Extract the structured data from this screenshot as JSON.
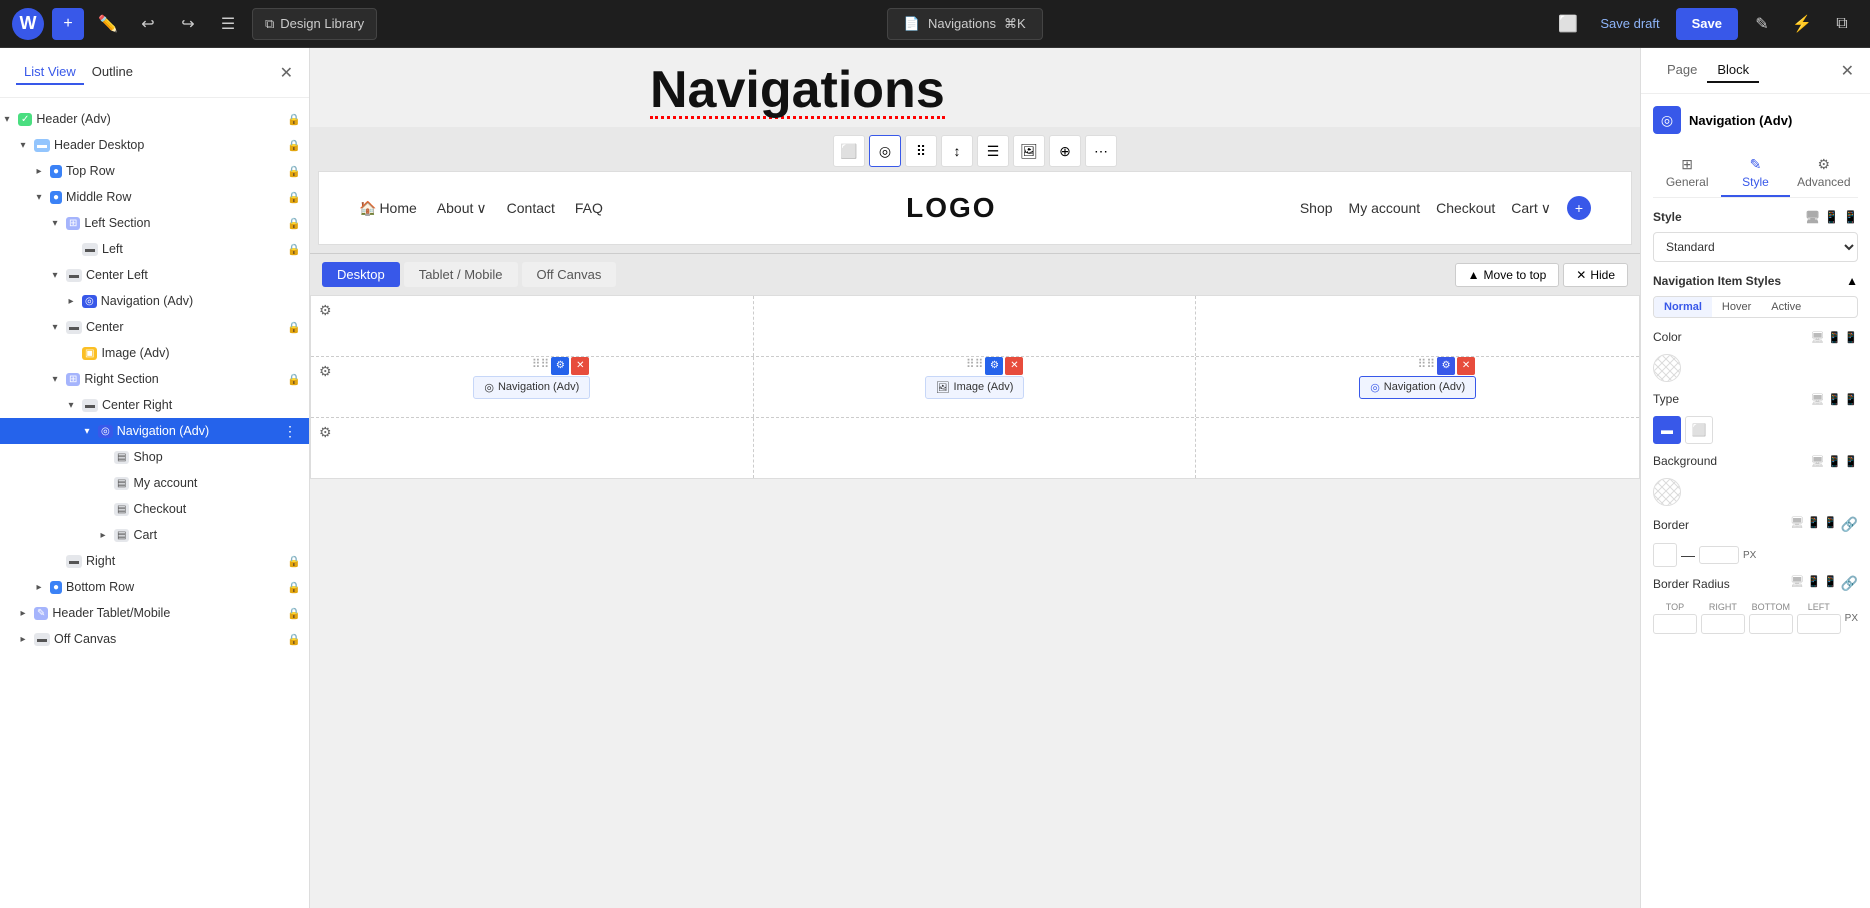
{
  "topBar": {
    "wpLogo": "W",
    "addLabel": "+",
    "designLibraryLabel": "Design Library",
    "navigationsLabel": "Navigations",
    "shortcut": "⌘K",
    "saveDraftLabel": "Save draft",
    "saveLabel": "Save"
  },
  "leftPanel": {
    "tab1": "List View",
    "tab2": "Outline",
    "tree": [
      {
        "id": "header-adv",
        "label": "Header (Adv)",
        "indent": 0,
        "expanded": true,
        "hasToggle": true,
        "icon": "☑",
        "locked": true
      },
      {
        "id": "header-desktop",
        "label": "Header Desktop",
        "indent": 1,
        "expanded": true,
        "hasToggle": true,
        "icon": "⬜",
        "locked": true
      },
      {
        "id": "top-row",
        "label": "Top Row",
        "indent": 2,
        "expanded": false,
        "hasToggle": true,
        "icon": "🔵",
        "locked": true
      },
      {
        "id": "middle-row",
        "label": "Middle Row",
        "indent": 2,
        "expanded": true,
        "hasToggle": true,
        "icon": "🔵",
        "locked": true
      },
      {
        "id": "left-section",
        "label": "Left Section",
        "indent": 3,
        "expanded": true,
        "hasToggle": true,
        "icon": "⟨⟩",
        "locked": true
      },
      {
        "id": "left",
        "label": "Left",
        "indent": 4,
        "expanded": false,
        "hasToggle": false,
        "icon": "▬",
        "locked": true
      },
      {
        "id": "center-left",
        "label": "Center Left",
        "indent": 3,
        "expanded": true,
        "hasToggle": true,
        "icon": "▬",
        "locked": false
      },
      {
        "id": "navigation-adv-1",
        "label": "Navigation (Adv)",
        "indent": 4,
        "expanded": false,
        "hasToggle": true,
        "icon": "◎",
        "locked": false
      },
      {
        "id": "center",
        "label": "Center",
        "indent": 3,
        "expanded": true,
        "hasToggle": true,
        "icon": "▬",
        "locked": true
      },
      {
        "id": "image-adv",
        "label": "Image (Adv)",
        "indent": 4,
        "expanded": false,
        "hasToggle": false,
        "icon": "🖼",
        "locked": false
      },
      {
        "id": "right-section",
        "label": "Right Section",
        "indent": 3,
        "expanded": true,
        "hasToggle": true,
        "icon": "⟨⟩",
        "locked": true
      },
      {
        "id": "center-right",
        "label": "Center Right",
        "indent": 4,
        "expanded": true,
        "hasToggle": true,
        "icon": "▬",
        "locked": false
      },
      {
        "id": "navigation-adv-2",
        "label": "Navigation (Adv)",
        "indent": 5,
        "expanded": true,
        "hasToggle": true,
        "icon": "◎",
        "locked": false,
        "selected": true
      },
      {
        "id": "shop",
        "label": "Shop",
        "indent": 6,
        "expanded": false,
        "hasToggle": false,
        "icon": "▤",
        "locked": false
      },
      {
        "id": "my-account",
        "label": "My account",
        "indent": 6,
        "expanded": false,
        "hasToggle": false,
        "icon": "▤",
        "locked": false
      },
      {
        "id": "checkout",
        "label": "Checkout",
        "indent": 6,
        "expanded": false,
        "hasToggle": false,
        "icon": "▤",
        "locked": false
      },
      {
        "id": "cart",
        "label": "Cart",
        "indent": 6,
        "expanded": false,
        "hasToggle": true,
        "icon": "▤",
        "locked": false
      },
      {
        "id": "right",
        "label": "Right",
        "indent": 3,
        "expanded": false,
        "hasToggle": false,
        "icon": "▬",
        "locked": true
      },
      {
        "id": "bottom-row",
        "label": "Bottom Row",
        "indent": 2,
        "expanded": false,
        "hasToggle": true,
        "icon": "🔵",
        "locked": true
      },
      {
        "id": "header-tablet-mobile",
        "label": "Header Tablet/Mobile",
        "indent": 1,
        "expanded": false,
        "hasToggle": true,
        "icon": "✎",
        "locked": true
      },
      {
        "id": "off-canvas",
        "label": "Off Canvas",
        "indent": 1,
        "expanded": false,
        "hasToggle": true,
        "icon": "▬",
        "locked": true
      }
    ]
  },
  "canvas": {
    "pageTitle": "Navigations",
    "navItems": {
      "home": "Home",
      "about": "About",
      "contact": "Contact",
      "faq": "FAQ",
      "logo": "LOGO",
      "shop": "Shop",
      "myAccount": "My account",
      "checkout": "Checkout",
      "cart": "Cart"
    },
    "viewTabs": [
      "Desktop",
      "Tablet / Mobile",
      "Off Canvas"
    ],
    "activeViewTab": "Desktop",
    "moveToTopLabel": "Move to top",
    "hideLabel": "Hide",
    "gridBlocks": [
      {
        "id": "nav-left",
        "label": "Navigation (Adv)",
        "type": "nav"
      },
      {
        "id": "image-center",
        "label": "Image (Adv)",
        "type": "image"
      },
      {
        "id": "nav-right",
        "label": "Navigation (Adv)",
        "type": "nav"
      }
    ]
  },
  "rightPanel": {
    "tabs": [
      "Page",
      "Block"
    ],
    "activeTab": "Block",
    "blockTitle": "Navigation (Adv)",
    "generalStyleTabs": [
      "General",
      "Style",
      "Advanced"
    ],
    "activeGsTab": "Style",
    "styleLabel": "Style",
    "styleOptions": [
      "Standard"
    ],
    "selectedStyle": "Standard",
    "navItemStylesLabel": "Navigation Item Styles",
    "nisCollapseIcon": "▲",
    "nisTabs": [
      "Normal",
      "Hover",
      "Active"
    ],
    "activeNisTab": "Normal",
    "colorLabel": "Color",
    "typeLabel": "Type",
    "backgroundLabel": "Background",
    "borderLabel": "Border",
    "borderDash": "—",
    "borderUnit": "PX",
    "borderRadiusLabel": "Border Radius",
    "brLabels": [
      "TOP",
      "RIGHT",
      "BOTTOM",
      "LEFT"
    ],
    "brUnit": "PX"
  }
}
